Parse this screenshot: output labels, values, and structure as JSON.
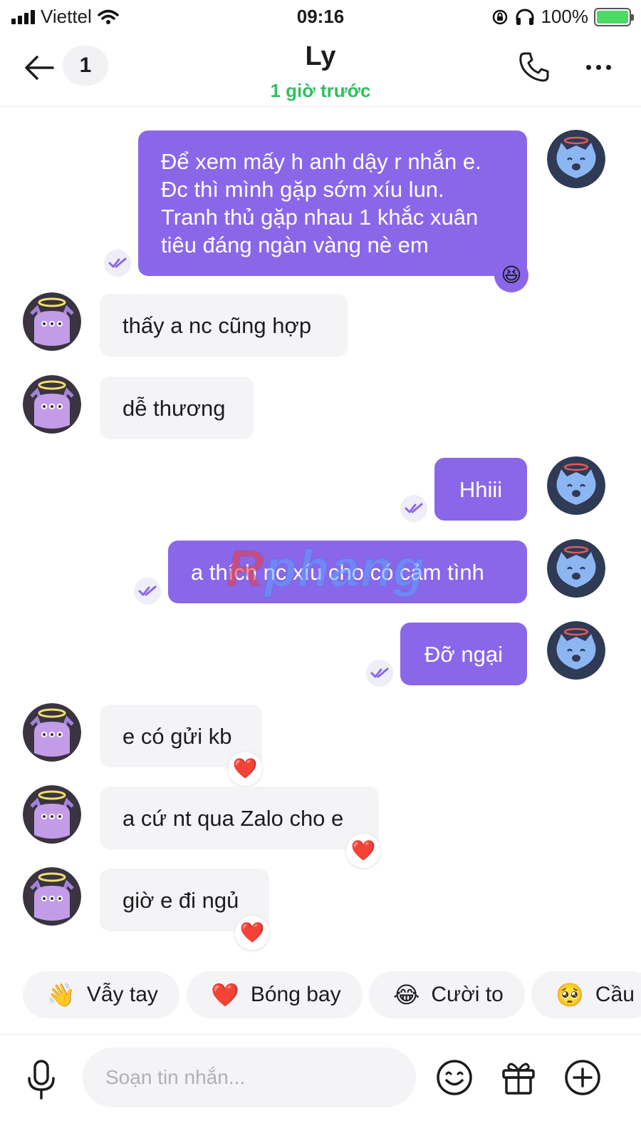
{
  "status_bar": {
    "carrier": "Viettel",
    "time": "09:16",
    "battery": "100%"
  },
  "header": {
    "unread_count": "1",
    "contact_name": "Ly",
    "last_seen": "1 giờ trước"
  },
  "messages": [
    {
      "direction": "out",
      "lines": [
        "Để xem mấy h anh dậy r nhắn e.",
        "Đc thì mình gặp sớm xíu lun.",
        "Tranh thủ gặp nhau 1 khắc xuân",
        "tiêu đáng ngàn vàng nè em"
      ],
      "reaction": "😆"
    },
    {
      "direction": "in",
      "text": "thấy a nc cũng hợp"
    },
    {
      "direction": "in",
      "text": "dễ thương"
    },
    {
      "direction": "out",
      "text": "Hhiii"
    },
    {
      "direction": "out",
      "text": "a thích nc xíu cho có cảm tình"
    },
    {
      "direction": "out",
      "text": "Đỡ ngại"
    },
    {
      "direction": "in",
      "text": "e có gửi kb",
      "reaction": "❤️"
    },
    {
      "direction": "in",
      "text": "a cứ nt qua Zalo cho e",
      "reaction": "❤️"
    },
    {
      "direction": "in",
      "text": "giờ e đi ngủ",
      "reaction": "❤️"
    }
  ],
  "watermark": {
    "first": "R",
    "rest": "phang"
  },
  "quick_reactions": [
    {
      "emoji": "👋",
      "label": "Vẫy tay"
    },
    {
      "emoji": "❤️",
      "label": "Bóng bay"
    },
    {
      "emoji": "😂",
      "label": "Cười to"
    },
    {
      "emoji": "🥺",
      "label": "Cầu"
    }
  ],
  "composer": {
    "placeholder": "Soạn tin nhắn..."
  },
  "colors": {
    "outgoing_bubble": "#8a67e8",
    "incoming_bubble": "#f4f4f6",
    "last_seen_green": "#2fc160"
  }
}
